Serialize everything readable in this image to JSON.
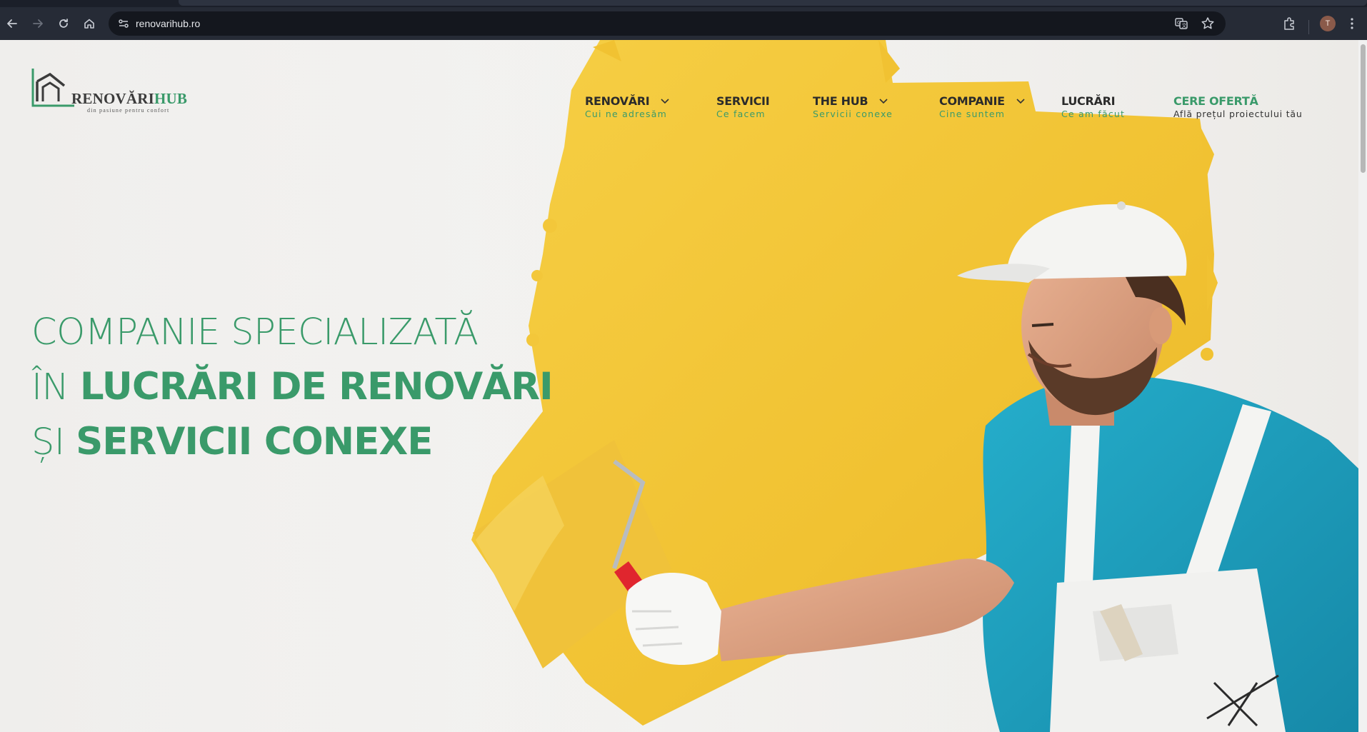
{
  "browser": {
    "url": "renovarihub.ro",
    "profile_initial": "T"
  },
  "logo": {
    "brand_main": "RENOVĂRI",
    "brand_accent": "HUB",
    "tagline": "din pasiune pentru confort"
  },
  "nav": {
    "items": [
      {
        "title": "RENOVĂRI",
        "sub": "Cui ne adresăm",
        "has_dropdown": true
      },
      {
        "title": "SERVICII",
        "sub": "Ce facem",
        "has_dropdown": false
      },
      {
        "title": "THE HUB",
        "sub": "Servicii conexe",
        "has_dropdown": true
      },
      {
        "title": "COMPANIE",
        "sub": "Cine suntem",
        "has_dropdown": true
      },
      {
        "title": "LUCRĂRI",
        "sub": "Ce am făcut",
        "has_dropdown": false
      },
      {
        "title": "CERE OFERTĂ",
        "sub": "Află prețul proiectului tău",
        "has_dropdown": false
      }
    ]
  },
  "hero": {
    "line1": "COMPANIE SPECIALIZATĂ",
    "line2_prefix": "ÎN ",
    "line2_bold": "LUCRĂRI DE RENOVĂRI",
    "line3_prefix": "ȘI ",
    "line3_bold": "SERVICII CONEXE"
  },
  "colors": {
    "accent": "#3a9a6a",
    "paint": "#f2c334",
    "shirt": "#1fa3c2"
  }
}
